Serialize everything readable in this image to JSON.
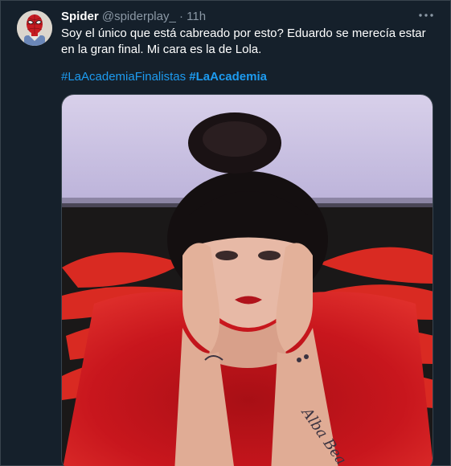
{
  "tweet": {
    "display_name": "Spider",
    "handle": "@spiderplay_",
    "separator": " · ",
    "time": "11h",
    "text": "Soy el único que está cabreado por esto? Eduardo se merecía estar en la gran final. Mi cara es la de Lola.",
    "hashtags": [
      "#LaAcademiaFinalistas",
      "#LaAcademia"
    ]
  },
  "media": {
    "tattoo_text": "Alba Bea"
  },
  "icons": {
    "avatar": "spiderman-avatar",
    "more": "more-dots-icon"
  },
  "colors": {
    "background": "#15202b",
    "hashtag": "#1d9bf0",
    "secondary_text": "#8b98a5",
    "dress": "#c8161d"
  }
}
